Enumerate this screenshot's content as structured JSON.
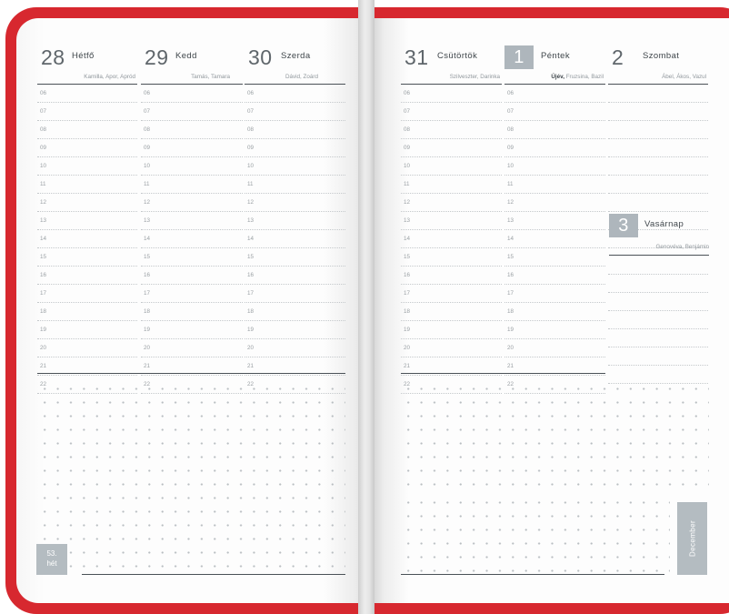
{
  "hours": [
    "06",
    "07",
    "08",
    "09",
    "10",
    "11",
    "12",
    "13",
    "14",
    "15",
    "16",
    "17",
    "18",
    "19",
    "20",
    "21",
    "22"
  ],
  "left_days": [
    {
      "num": "28",
      "name": "Hétfő",
      "names": "Kamilla, Apor, Apród"
    },
    {
      "num": "29",
      "name": "Kedd",
      "names": "Tamás, Tamara"
    },
    {
      "num": "30",
      "name": "Szerda",
      "names": "Dávid, Zoárd"
    }
  ],
  "right_days": [
    {
      "num": "31",
      "name": "Csütörtök",
      "names": "Szilveszter, Darinka"
    },
    {
      "num": "1",
      "name": "Péntek",
      "holiday": "Újév,",
      "names": "Fruzsina, Bazil"
    },
    {
      "num": "2",
      "name": "Szombat",
      "names": "Ábel, Ákos, Vazul"
    }
  ],
  "sunday": {
    "num": "3",
    "name": "Vasárnap",
    "names": "Genovéva, Benjámin"
  },
  "week_label": {
    "num": "53.",
    "word": "hét"
  },
  "month_label": "December",
  "colors": {
    "cover": "#d7282f",
    "accent_box": "#aeb6bc",
    "rule": "#4a5157"
  }
}
